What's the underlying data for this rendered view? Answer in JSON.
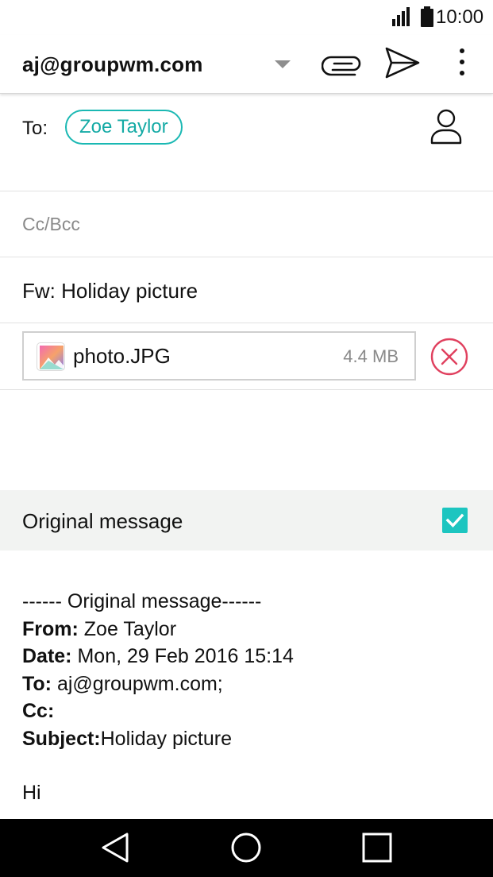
{
  "status_bar": {
    "time": "10:00",
    "signal_icon": "signal-bars-icon",
    "battery_icon": "battery-icon"
  },
  "app_bar": {
    "account": "aj@groupwm.com",
    "actions": [
      "attach-icon",
      "send-icon",
      "more-vert-icon"
    ]
  },
  "compose": {
    "to_label": "To:",
    "recipient_chip": "Zoe Taylor",
    "cc_bcc_placeholder": "Cc/Bcc",
    "subject": "Fw: Holiday picture",
    "attachment": {
      "name": "photo.JPG",
      "size": "4.4 MB"
    }
  },
  "original_message": {
    "label": "Original message",
    "included": true,
    "header_line": "------ Original message------",
    "from_label": "From:",
    "from_value": " Zoe Taylor",
    "date_label": "Date:",
    "date_value": " Mon, 29 Feb 2016 15:14",
    "to_label": "To:",
    "to_value": " aj@groupwm.com;",
    "cc_label": "Cc:",
    "cc_value": "",
    "subject_label": "Subject:",
    "subject_value": "Holiday picture",
    "greeting": "Hi"
  },
  "colors": {
    "accent": "#1ab8b3",
    "remove": "#e0405e",
    "nav_bar": "#000000"
  }
}
